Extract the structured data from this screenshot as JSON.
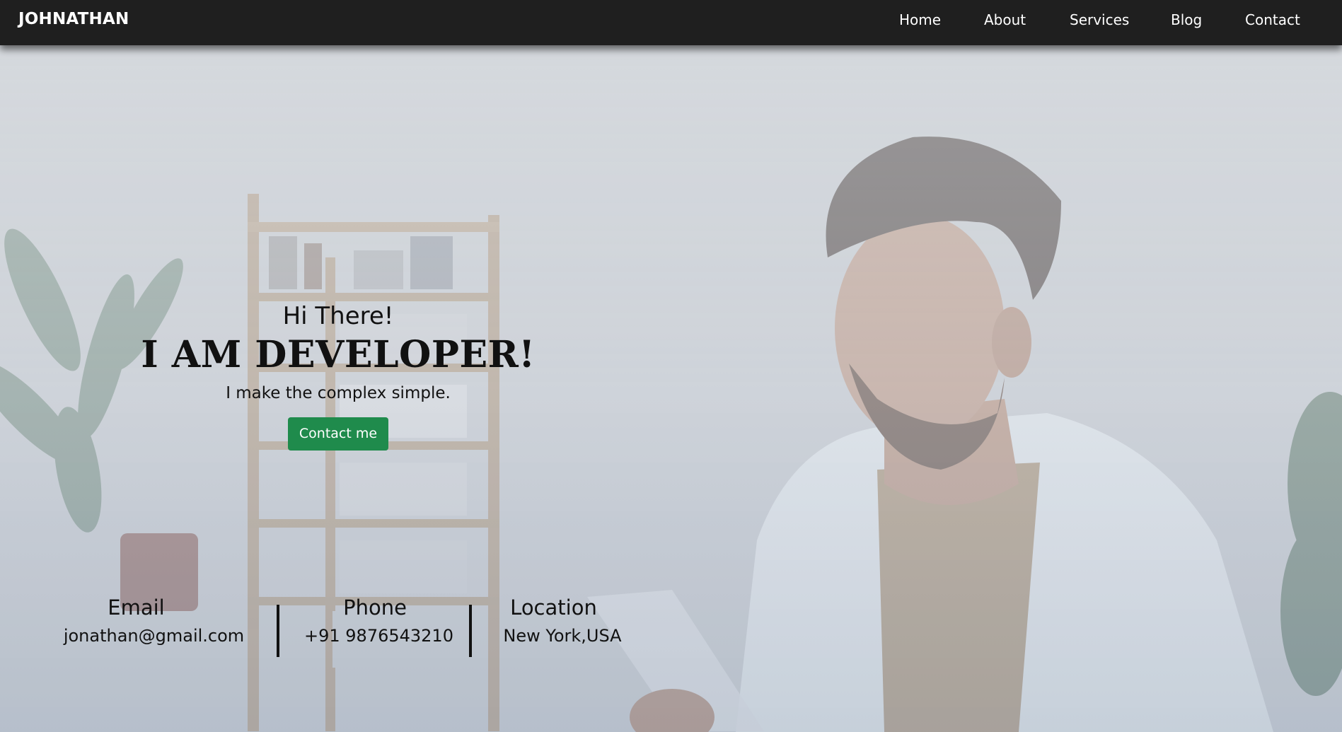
{
  "navbar": {
    "brand": "JOHNATHAN",
    "links": [
      {
        "label": "Home"
      },
      {
        "label": "About"
      },
      {
        "label": "Services"
      },
      {
        "label": "Blog"
      },
      {
        "label": "Contact"
      }
    ]
  },
  "hero": {
    "greeting": "Hi There!",
    "headline": "I AM DEVELOPER!",
    "tagline": "I make the complex simple.",
    "cta_label": "Contact me"
  },
  "contact_info": {
    "email": {
      "label": "Email",
      "value": "jonathan@gmail.com"
    },
    "phone": {
      "label": "Phone",
      "value": "+91 9876543210"
    },
    "location": {
      "label": "Location",
      "value": "New York,USA"
    }
  },
  "colors": {
    "navbar_bg": "#1f1f1f",
    "cta_bg": "#1f8b4c",
    "text": "#111111"
  }
}
